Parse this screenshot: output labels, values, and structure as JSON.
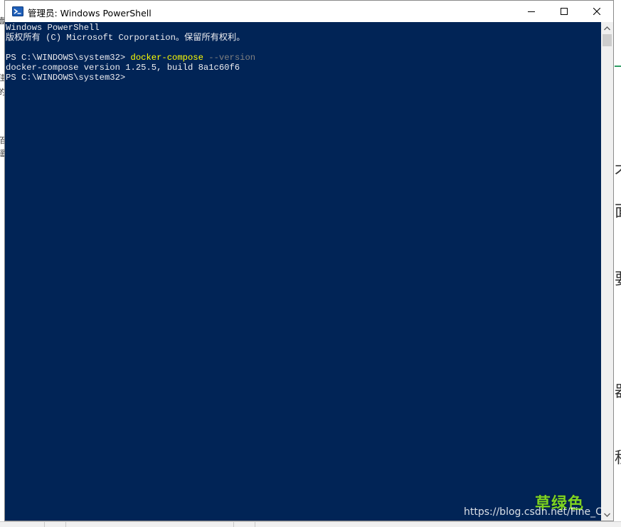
{
  "window": {
    "title": "管理员: Windows PowerShell",
    "buttons": {
      "minimize": "minimize",
      "maximize": "maximize",
      "close": "close"
    }
  },
  "console": {
    "background": "#012456",
    "foreground": "#eeedf0",
    "command_color": "#ffff00",
    "parameter_color": "#808080",
    "lines": {
      "banner_1": "Windows PowerShell",
      "banner_2": "版权所有 (C) Microsoft Corporation。保留所有权利。",
      "prompt_1": "PS C:\\WINDOWS\\system32> ",
      "command": "docker-compose",
      "parameter": " --version",
      "output": "docker-compose version 1.25.5, build 8a1c60f6",
      "prompt_2": "PS C:\\WINDOWS\\system32>"
    }
  },
  "watermark": {
    "label": "草绿色",
    "url": "https://blog.csdn.net/Fine_C"
  },
  "background_fragments": {
    "left": [
      "壹",
      "佳",
      "的",
      "佰",
      "遥"
    ],
    "right": [
      "不",
      "面",
      "要",
      "器",
      "程"
    ]
  }
}
